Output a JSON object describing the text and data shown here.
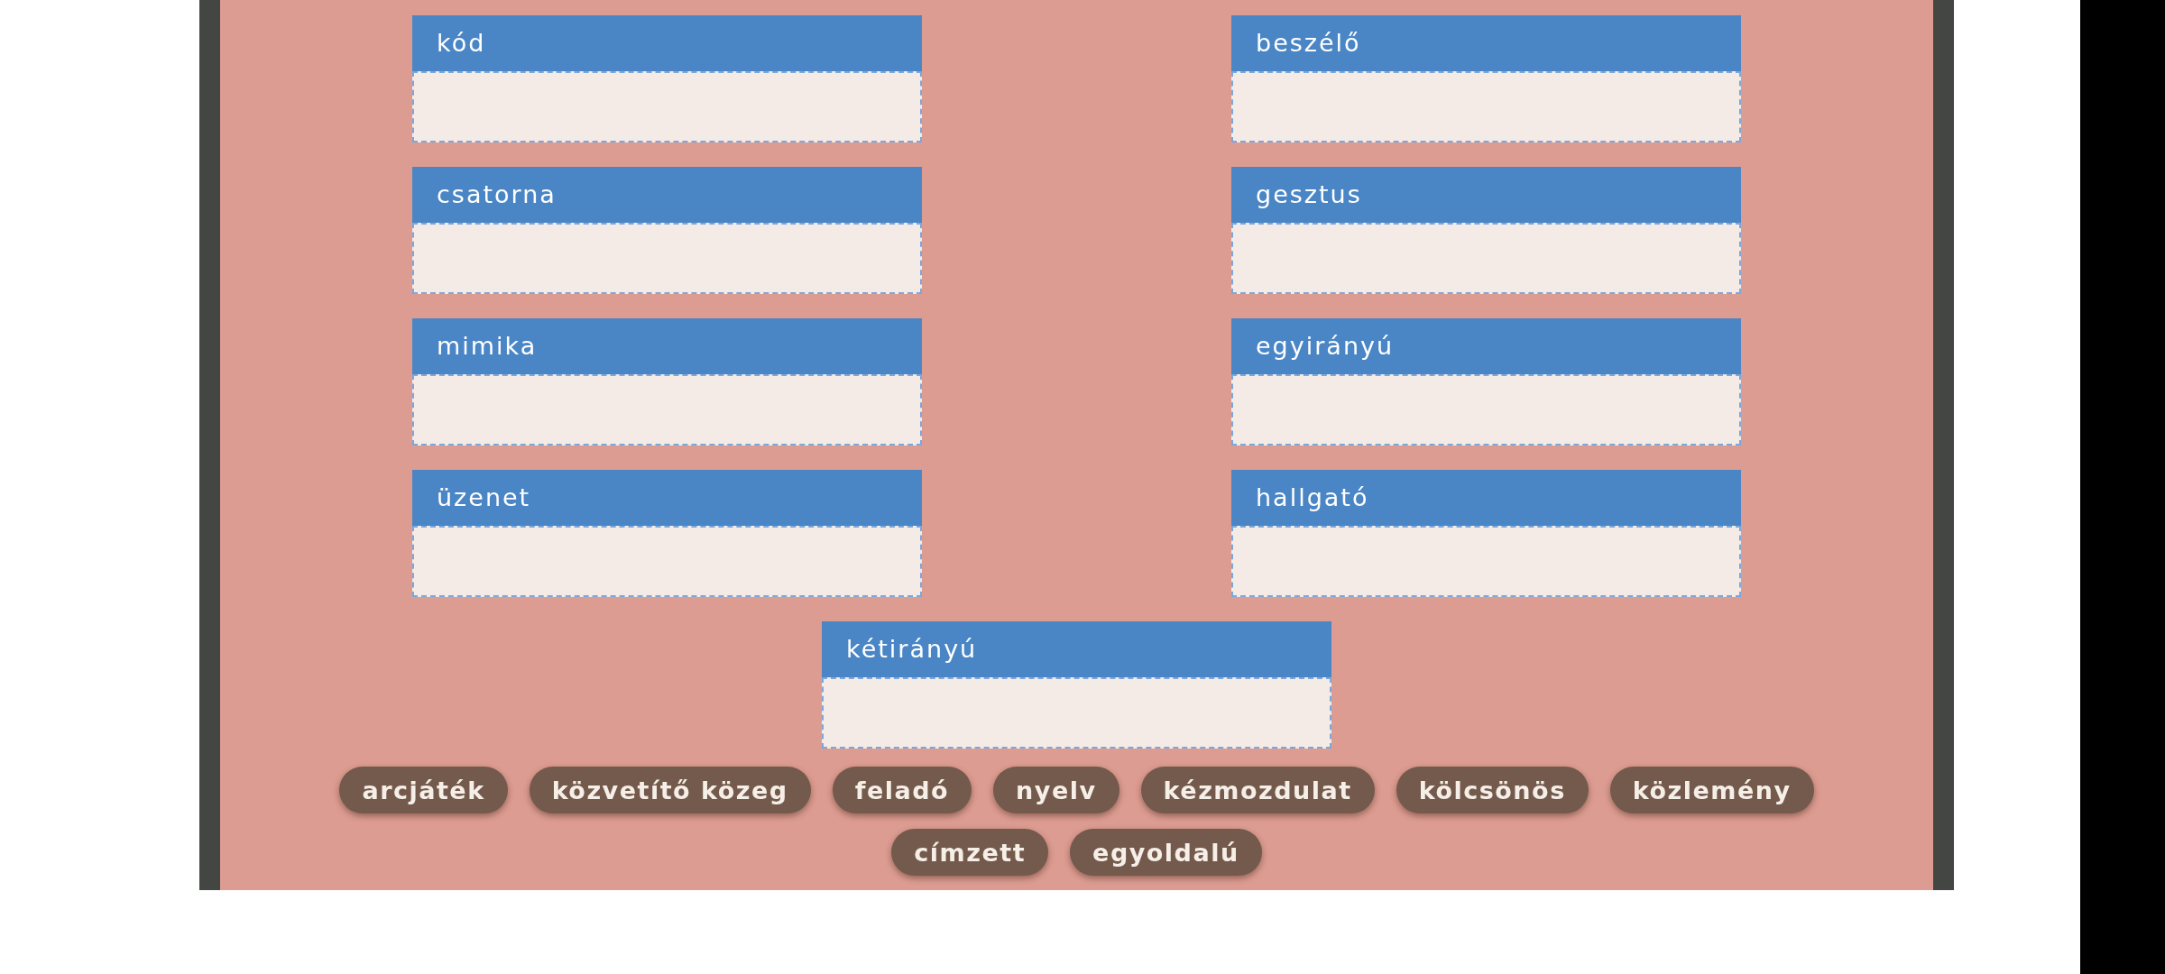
{
  "categories": [
    {
      "label": "kód"
    },
    {
      "label": "beszélő"
    },
    {
      "label": "csatorna"
    },
    {
      "label": "gesztus"
    },
    {
      "label": "mimika"
    },
    {
      "label": "egyirányú"
    },
    {
      "label": "üzenet"
    },
    {
      "label": "hallgató"
    },
    {
      "label": "kétirányú"
    }
  ],
  "word_bank": [
    "arcjáték",
    "közvetítő közeg",
    "feladó",
    "nyelv",
    "kézmozdulat",
    "kölcsönös",
    "közlemény",
    "címzett",
    "egyoldalú"
  ]
}
